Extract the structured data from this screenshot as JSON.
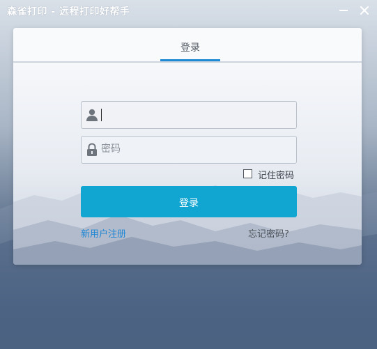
{
  "window": {
    "title": "森雀打印 - 远程打印好帮手",
    "minimize_icon": "minimize-icon",
    "close_icon": "close-icon"
  },
  "tabs": [
    {
      "label": "登录",
      "active": true
    }
  ],
  "form": {
    "username": {
      "value": "",
      "placeholder": "",
      "icon": "user-icon"
    },
    "password": {
      "value": "",
      "placeholder": "密码",
      "icon": "lock-icon"
    },
    "remember": {
      "label": "记住密码",
      "checked": false
    },
    "submit_label": "登录",
    "register_link": "新用户注册",
    "forgot_link": "忘记密码?"
  },
  "colors": {
    "accent": "#11a6d2",
    "tab_underline": "#1e8ad6",
    "link": "#1e86d4"
  }
}
